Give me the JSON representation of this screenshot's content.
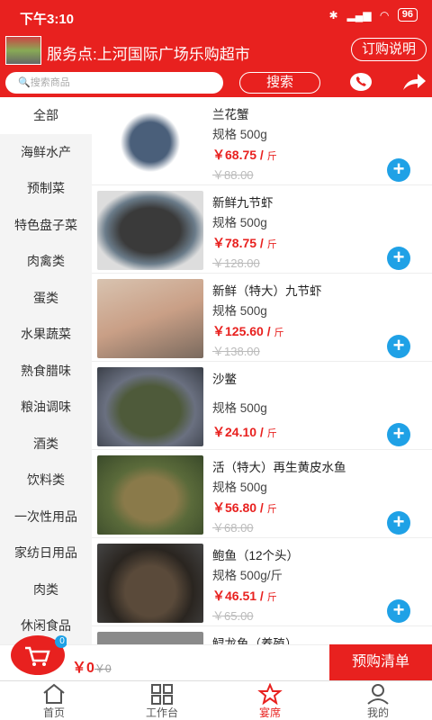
{
  "status": {
    "time": "下午3:10",
    "battery": "96"
  },
  "header": {
    "service_point": "服务点:上河国际广场乐购超市",
    "order_btn": "订购说明"
  },
  "search": {
    "placeholder": "🔍搜索商品",
    "button": "搜索"
  },
  "sidebar": {
    "items": [
      "全部",
      "海鲜水产",
      "预制菜",
      "特色盘子菜",
      "肉禽类",
      "蛋类",
      "水果蔬菜",
      "熟食腊味",
      "粮油调味",
      "酒类",
      "饮料类",
      "一次性用品",
      "家纺日用品",
      "肉类",
      "休闲食品"
    ]
  },
  "products": [
    {
      "name": "兰花蟹",
      "spec": "规格 500g",
      "price": "￥68.75 /",
      "unit": "斤",
      "orig": "￥88.00"
    },
    {
      "name": "新鲜九节虾",
      "spec": "规格 500g",
      "price": "￥78.75 /",
      "unit": "斤",
      "orig": "￥128.00"
    },
    {
      "name": "新鲜（特大）九节虾",
      "spec": "规格 500g",
      "price": "￥125.60 /",
      "unit": "斤",
      "orig": "￥138.00"
    },
    {
      "name": "沙鳖",
      "spec": "规格 500g",
      "price": "￥24.10 /",
      "unit": "斤",
      "orig": ""
    },
    {
      "name": "活（特大）再生黄皮水鱼",
      "spec": "规格 500g",
      "price": "￥56.80 /",
      "unit": "斤",
      "orig": "￥68.00"
    },
    {
      "name": "鲍鱼（12个头）",
      "spec": "规格 500g/斤",
      "price": "￥46.51 /",
      "unit": "斤",
      "orig": "￥65.00"
    },
    {
      "name": "鲟龙鱼（养殖）",
      "spec": "",
      "price": "",
      "unit": "",
      "orig": ""
    }
  ],
  "cart": {
    "count": "0",
    "total": "￥0",
    "orig": "￥0",
    "preorder": "预购清单"
  },
  "tabs": [
    "首页",
    "工作台",
    "宴席",
    "我的"
  ],
  "colors": {
    "accent": "#e8211f",
    "add": "#1fa1e6"
  }
}
